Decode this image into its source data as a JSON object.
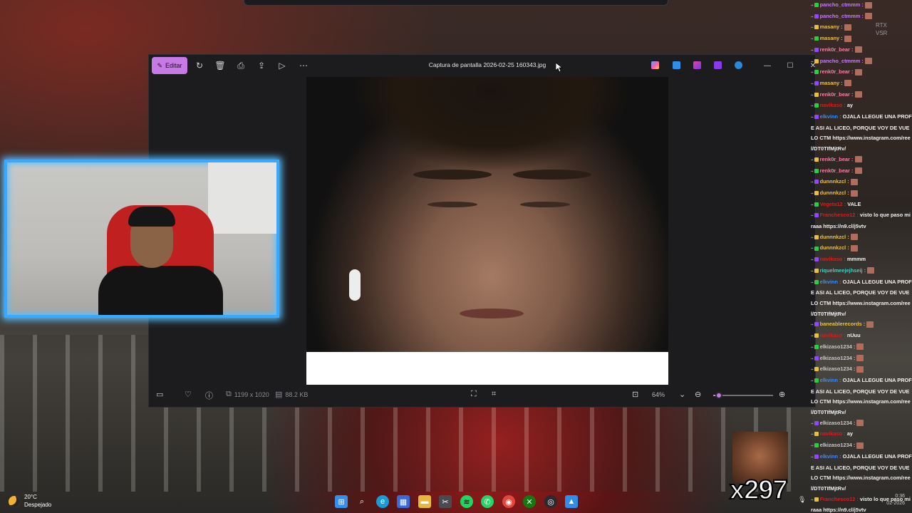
{
  "photos_window": {
    "edit_label": "Editar",
    "title": "Captura de pantalla 2026-02-25 160343.jpg",
    "dimensions": "1199 x 1020",
    "file_size": "88.2 KB",
    "zoom": "64%",
    "zoom_fraction": 0.1,
    "accent_color": "#c77ae6"
  },
  "overlay": {
    "rtx": "RTX",
    "vsr": "VSR",
    "emote_count": "x297"
  },
  "chat": [
    {
      "user": "pancho_ctmmm :",
      "color": "#c678ff",
      "msg": ""
    },
    {
      "user": "pancho_ctmmm :",
      "color": "#c678ff",
      "msg": ""
    },
    {
      "user": "masany :",
      "color": "#e8c040",
      "msg": ""
    },
    {
      "user": "masany :",
      "color": "#e8c040",
      "msg": ""
    },
    {
      "user": "renk0r_bear :",
      "color": "#ff7aa8",
      "msg": ""
    },
    {
      "user": "pancho_ctmmm :",
      "color": "#c678ff",
      "msg": ""
    },
    {
      "user": "renk0r_bear :",
      "color": "#ff7aa8",
      "msg": ""
    },
    {
      "user": "masany :",
      "color": "#e8c040",
      "msg": ""
    },
    {
      "user": "renk0r_bear :",
      "color": "#ff7aa8",
      "msg": ""
    },
    {
      "user": "navikaso :",
      "color": "#d02020",
      "msg": "ay"
    },
    {
      "user": "elkvinn :",
      "color": "#3a8cff",
      "msg": "OJALA LLEGUE UNA PROFE ASI AL LICEO, PORQUE VOY DE VUELO CTM https://www.instagram.com/reel/DT0TIfMjtRv/",
      "wrap": true
    },
    {
      "user": "renk0r_bear :",
      "color": "#ff7aa8",
      "msg": ""
    },
    {
      "user": "renk0r_bear :",
      "color": "#ff7aa8",
      "msg": ""
    },
    {
      "user": "dunnnkzcl :",
      "color": "#e8c040",
      "msg": ""
    },
    {
      "user": "dunnnkzcl :",
      "color": "#e8c040",
      "msg": ""
    },
    {
      "user": "Vegeta12 :",
      "color": "#d02020",
      "msg": "VALE"
    },
    {
      "user": "Franchesco12 :",
      "color": "#d02020",
      "msg": "visto lo que paso miraaa https://n9.cl/j5vtv",
      "wrap": true
    },
    {
      "user": "dunnnkzcl :",
      "color": "#e8c040",
      "msg": ""
    },
    {
      "user": "dunnnkzcl :",
      "color": "#e8c040",
      "msg": ""
    },
    {
      "user": "navikaso :",
      "color": "#d02020",
      "msg": "mmmm"
    },
    {
      "user": "riquelmeejejhseij :",
      "color": "#40d0c0",
      "msg": ""
    },
    {
      "user": "elkvinn :",
      "color": "#3a8cff",
      "msg": "OJALA LLEGUE UNA PROFE ASI AL LICEO, PORQUE VOY DE VUELO CTM https://www.instagram.com/reel/DT0TIfMjtRv/",
      "wrap": true
    },
    {
      "user": "baneablerecords :",
      "color": "#e8c040",
      "msg": ""
    },
    {
      "user": "navikaso :",
      "color": "#d02020",
      "msg": "nUuu"
    },
    {
      "user": "elkizaso1234 :",
      "color": "#c8c8c8",
      "msg": ""
    },
    {
      "user": "elkizaso1234 :",
      "color": "#c8c8c8",
      "msg": ""
    },
    {
      "user": "elkizaso1234 :",
      "color": "#c8c8c8",
      "msg": ""
    },
    {
      "user": "elkvinn :",
      "color": "#3a8cff",
      "msg": "OJALA LLEGUE UNA PROFE ASI AL LICEO, PORQUE VOY DE VUELO CTM https://www.instagram.com/reel/DT0TIfMjtRv/",
      "wrap": true
    },
    {
      "user": "elkizaso1234 :",
      "color": "#c8c8c8",
      "msg": ""
    },
    {
      "user": "navikaso :",
      "color": "#d02020",
      "msg": "ay"
    },
    {
      "user": "elkizaso1234 :",
      "color": "#c8c8c8",
      "msg": ""
    },
    {
      "user": "elkvinn :",
      "color": "#3a8cff",
      "msg": "OJALA LLEGUE UNA PROFE ASI AL LICEO, PORQUE VOY DE VUELO CTM https://www.instagram.com/reel/DT0TIfMjtRv/",
      "wrap": true
    },
    {
      "user": "Franchesco12 :",
      "color": "#d02020",
      "msg": "visto lo que paso miraaa https://n9.cl/j5vtv",
      "wrap": true
    },
    {
      "user": "pancho_ctmmm :",
      "color": "#c678ff",
      "msg": ""
    }
  ],
  "taskbar": {
    "temperature": "20°C",
    "weather": "Despejado",
    "time": "0:36",
    "date": "02-2026"
  }
}
